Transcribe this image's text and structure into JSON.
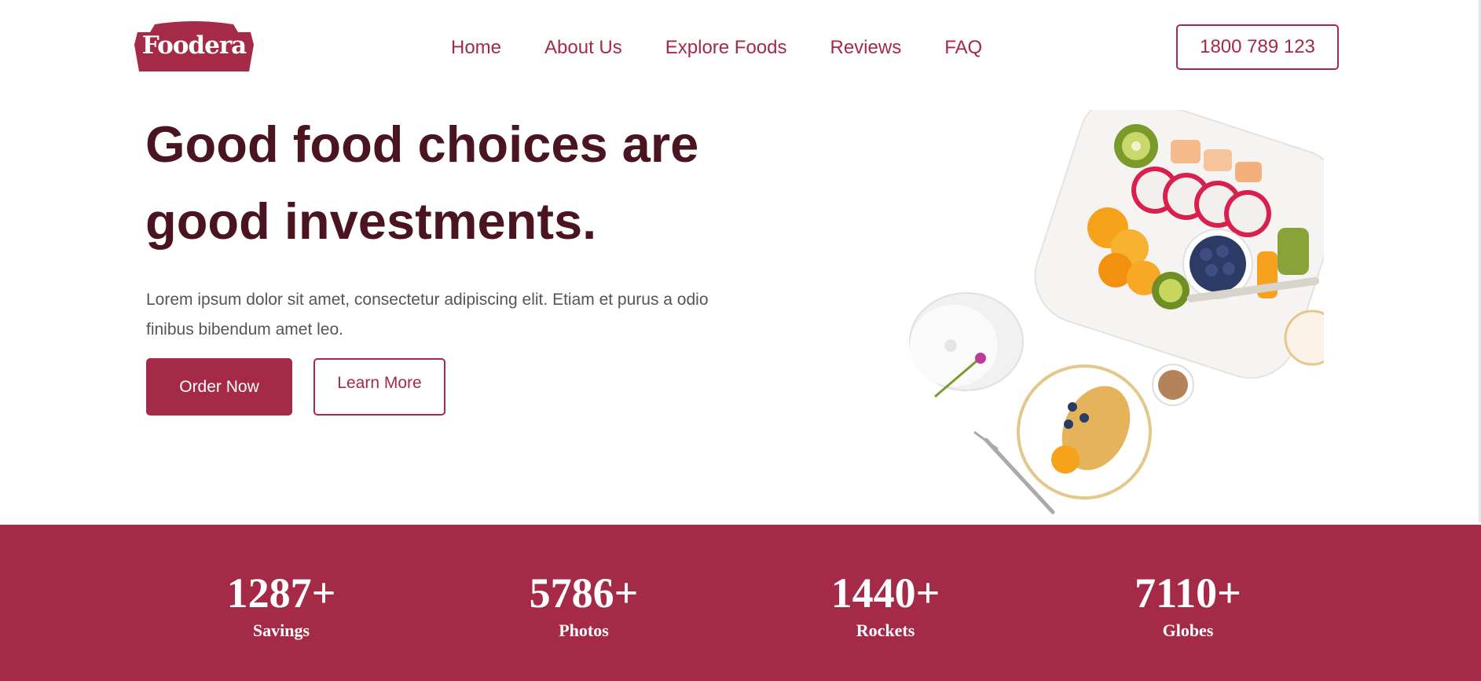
{
  "brand": {
    "name": "Foodera",
    "color": "#a52a48"
  },
  "nav": {
    "items": [
      {
        "label": "Home"
      },
      {
        "label": "About Us"
      },
      {
        "label": "Explore Foods"
      },
      {
        "label": "Reviews"
      },
      {
        "label": "FAQ"
      }
    ]
  },
  "header": {
    "phone": "1800 789 123"
  },
  "hero": {
    "title_line1": "Good food choices are",
    "title_line2": "good investments.",
    "description": "Lorem ipsum dolor sit amet, consectetur adipiscing elit. Etiam et purus a odio finibus bibendum amet leo.",
    "primary_button": "Order Now",
    "secondary_button": "Learn More",
    "image_icon": "food-platter-photo"
  },
  "stats": [
    {
      "value": "1287+",
      "label": "Savings"
    },
    {
      "value": "5786+",
      "label": "Photos"
    },
    {
      "value": "1440+",
      "label": "Rockets"
    },
    {
      "value": "7110+",
      "label": "Globes"
    }
  ]
}
